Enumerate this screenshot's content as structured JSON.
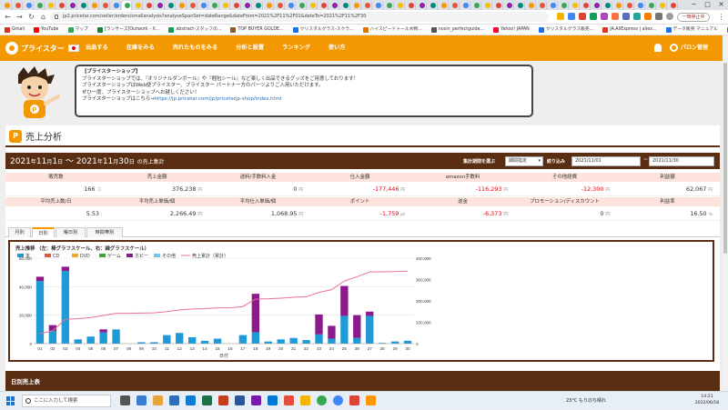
{
  "browser": {
    "url": "jp2.pricetar.com/seller/orders/smallanalysis?analyseSpanSet=dateRange&dateFrom=2021%2F11%2F01&dateTo=2021%2F11%2F30",
    "pause_label": "一時停止中",
    "bookmarks": [
      "Gmail",
      "YouTube",
      "マップ",
      "[ランサーズ]Outwork - X...",
      "abstract-スタッフの...",
      "TOP BUYER GOLDE...",
      "クリスタルグラス-スクラ...",
      "ハイスピードトール水物...",
      "nosin_perfectguide...",
      "Yahoo! JAPAN",
      "クリスタルグラス販売...",
      "JA.AliExpress | aliex...",
      "データ販売 マニュアル",
      "https://shoppingcar..."
    ],
    "bookmark_colors": [
      "#d93025",
      "#ff0000",
      "#34a853",
      "#188038",
      "#0f9d58",
      "#8b5a2b",
      "#1a73e8",
      "#e37400",
      "#555555",
      "#ff0033",
      "#1a73e8",
      "#e43225",
      "#1a73e8",
      "#5f6368"
    ]
  },
  "header": {
    "logo": "プライスター",
    "nav": [
      "出品する",
      "在庫をみる",
      "売れたものをみる",
      "分析と設置",
      "ランキング",
      "使い方"
    ],
    "password_link": "パロン管理"
  },
  "notice": {
    "lines": [
      "【プライスターショップ】",
      "プライスターショップでは、『オリジナルダンボール』や『梱包シール』など楽しく出品できるグッズをご用意しております！",
      "プライスターショップはWeb便プライスター、プライスター パートナー方のパーツよりご入用いただけます。",
      "ぜひ一度、プライスターショップへお越しください！",
      "",
      "プライスターショップはこちら→"
    ],
    "shop_url": "https://jp.pricetar.com/jp/pricetarjp-shop/index.html"
  },
  "page": {
    "title": "売上分析",
    "title_icon": "P"
  },
  "range": {
    "y1": "2021",
    "m1": "11",
    "d1": "1",
    "y2": "2021",
    "m2": "11",
    "d2": "30",
    "year": "年",
    "month": "月",
    "day": "日",
    "tilde": "〜",
    "suffix": "の売上集計",
    "select_label": "集計期間を選ぶ",
    "select_value": "期間指定",
    "narrow_label": "絞り込み",
    "date_from": "2021/11/01",
    "date_to": "2021/11/30"
  },
  "stats_row1": {
    "headers": [
      "販売数",
      "売上金額",
      "送料/手数料入金",
      "仕入金額",
      "amazon手数料",
      "その他経費",
      "利益額"
    ],
    "values": [
      "166",
      "376,238",
      "0",
      "-177,446",
      "-116,293",
      "-12,300",
      "62,067"
    ],
    "units": [
      "コ",
      "円",
      "円",
      "円",
      "円",
      "円",
      "円"
    ],
    "neg": [
      false,
      false,
      false,
      true,
      true,
      true,
      false
    ]
  },
  "stats_row2": {
    "headers": [
      "平均売上数/日",
      "平均売上単価/個",
      "平均仕入単価/個",
      "ポイント",
      "送金",
      "プロモーション/ディスカウント",
      "利益率"
    ],
    "values": [
      "5.53",
      "2,266.49",
      "1,068.95",
      "-1,759",
      "-6,373",
      "0",
      "16.50"
    ],
    "units": [
      "",
      "円",
      "円",
      "pt",
      "円",
      "円",
      "%"
    ],
    "neg": [
      false,
      false,
      false,
      true,
      true,
      false,
      false
    ]
  },
  "tabs": [
    "月別",
    "日別",
    "曜日別",
    "時間帯別"
  ],
  "active_tab": 1,
  "chart_data": {
    "type": "bar",
    "title": "売上推移 （左：棒グラフスケール、右：線グラフスケール）",
    "xlabel": "日付",
    "categories": [
      "01",
      "02",
      "03",
      "04",
      "05",
      "06",
      "07",
      "08",
      "09",
      "10",
      "11",
      "12",
      "13",
      "14",
      "15",
      "16",
      "17",
      "18",
      "19",
      "20",
      "21",
      "22",
      "23",
      "24",
      "25",
      "26",
      "27",
      "28",
      "29",
      "30"
    ],
    "ylim_left": [
      0,
      60000
    ],
    "ylim_right": [
      0,
      400000
    ],
    "left_ticks": [
      "0",
      "20,000",
      "40,000",
      "60,000"
    ],
    "right_ticks": [
      "0",
      "100,000",
      "200,000",
      "300,000",
      "400,000"
    ],
    "stacked": true,
    "series": [
      {
        "name": "本",
        "color": "#1e9bd7",
        "values": [
          44000,
          9000,
          51000,
          3000,
          5000,
          8000,
          10000,
          0,
          1000,
          1000,
          6000,
          7500,
          4500,
          2000,
          3500,
          0,
          6000,
          8000,
          1500,
          3000,
          4000,
          2500,
          6500,
          3500,
          19500,
          4000,
          19500,
          500,
          1500,
          2000
        ]
      },
      {
        "name": "CD",
        "color": "#e8523a",
        "values": [
          0,
          0,
          0,
          0,
          0,
          0,
          0,
          0,
          0,
          0,
          0,
          0,
          0,
          0,
          0,
          0,
          0,
          0,
          0,
          0,
          0,
          0,
          0,
          0,
          0,
          0,
          0,
          0,
          0,
          0
        ]
      },
      {
        "name": "DVD",
        "color": "#f5a623",
        "values": [
          0,
          0,
          0,
          0,
          0,
          0,
          0,
          0,
          0,
          0,
          0,
          0,
          0,
          0,
          0,
          0,
          0,
          0,
          0,
          0,
          0,
          0,
          0,
          0,
          0,
          0,
          0,
          0,
          0,
          0
        ]
      },
      {
        "name": "ゲーム",
        "color": "#3aaa35",
        "values": [
          0,
          0,
          0,
          0,
          0,
          0,
          0,
          0,
          0,
          0,
          0,
          0,
          0,
          0,
          0,
          0,
          0,
          0,
          0,
          0,
          0,
          0,
          0,
          0,
          0,
          0,
          0,
          0,
          0,
          0
        ]
      },
      {
        "name": "ホビー",
        "color": "#8b1a8b",
        "values": [
          3000,
          4000,
          3000,
          0,
          0,
          2000,
          0,
          0,
          0,
          0,
          0,
          0,
          0,
          0,
          0,
          0,
          0,
          27000,
          0,
          0,
          0,
          0,
          14000,
          9000,
          21000,
          16000,
          3000,
          0,
          0,
          0
        ]
      },
      {
        "name": "その他",
        "color": "#66ccee",
        "values": [
          0,
          0,
          0,
          0,
          0,
          0,
          0,
          0,
          0,
          0,
          0,
          0,
          0,
          0,
          0,
          0,
          0,
          0,
          0,
          0,
          0,
          0,
          0,
          0,
          0,
          0,
          0,
          0,
          0,
          0
        ]
      }
    ],
    "line": {
      "name": "売上累計（累計）",
      "color": "#e8709a",
      "values": [
        47000,
        60000,
        114000,
        117000,
        122000,
        132000,
        142000,
        142000,
        143000,
        144000,
        150000,
        157500,
        162000,
        164000,
        167500,
        167500,
        173500,
        208500,
        210000,
        213000,
        217000,
        219500,
        240000,
        252500,
        293000,
        313000,
        335500,
        336000,
        337500,
        339500
      ]
    }
  },
  "daily_title": "日別売上表",
  "taskbar": {
    "search_placeholder": "ここに入力して検索",
    "weather": "23°C もりのち晴れ",
    "time": "14:21",
    "date": "2022/06/18"
  }
}
